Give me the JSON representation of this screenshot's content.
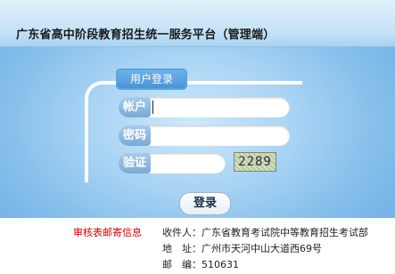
{
  "header": {
    "title": "广东省高中阶段教育招生统一服务平台（管理端）"
  },
  "login": {
    "panel_title": "用户登录",
    "account_label": "帐户",
    "account_value": "",
    "password_label": "密码",
    "password_value": "",
    "captcha_label": "验证",
    "captcha_value": "",
    "captcha_code": "2289",
    "submit_label": "登录"
  },
  "footer": {
    "mail_note": "审核表邮寄信息",
    "recipient": "收件人：广东省教育考试院中等教育招生考试部",
    "address": "地　址：广州市天河中山大道西69号",
    "postcode": "邮　编：510631"
  },
  "colors": {
    "accent_red": "#cc0000",
    "panel_blue": "#86bfeb"
  }
}
